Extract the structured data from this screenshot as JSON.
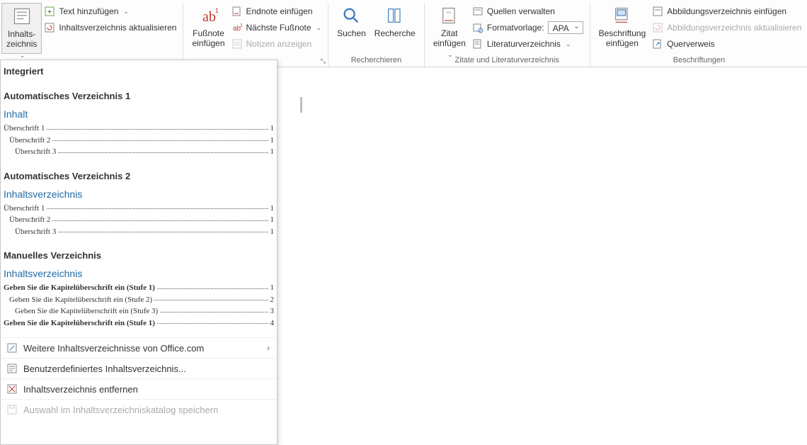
{
  "ribbon": {
    "toc": {
      "label_line1": "Inhalts-",
      "label_line2": "zeichnis"
    },
    "add_text": "Text hinzufügen",
    "update_toc": "Inhaltsverzeichnis aktualisieren",
    "footnote": {
      "label_line1": "Fußnote",
      "label_line2": "einfügen"
    },
    "insert_endnote": "Endnote einfügen",
    "next_footnote": "Nächste Fußnote",
    "show_notes": "Notizen anzeigen",
    "search": "Suchen",
    "research": "Recherche",
    "group_research": "Recherchieren",
    "citation": {
      "label_line1": "Zitat",
      "label_line2": "einfügen"
    },
    "manage_sources": "Quellen verwalten",
    "style_label": "Formatvorlage:",
    "style_value": "APA",
    "bibliography": "Literaturverzeichnis",
    "group_citations": "Zitate und Literaturverzeichnis",
    "caption": {
      "label_line1": "Beschriftung",
      "label_line2": "einfügen"
    },
    "insert_fig_index": "Abbildungsverzeichnis einfügen",
    "update_fig_index": "Abbildungsverzeichnis aktualisieren",
    "crossref": "Querverweis",
    "group_captions": "Beschriftungen"
  },
  "dropdown": {
    "integrated": "Integriert",
    "auto1_title": "Automatisches Verzeichnis 1",
    "auto1_heading": "Inhalt",
    "auto2_title": "Automatisches Verzeichnis 2",
    "auto2_heading": "Inhaltsverzeichnis",
    "manual_title": "Manuelles Verzeichnis",
    "manual_heading": "Inhaltsverzeichnis",
    "h1": "Überschrift 1",
    "h2": "Überschrift 2",
    "h3": "Überschrift 3",
    "m1": "Geben Sie die Kapitelüberschrift ein (Stufe 1)",
    "m2": "Geben Sie die Kapitelüberschrift ein (Stufe 2)",
    "m3": "Geben Sie die Kapitelüberschrift ein (Stufe 3)",
    "m1b": "Geben Sie die Kapitelüberschrift ein (Stufe 1)",
    "p1": "1",
    "p2": "2",
    "p3": "3",
    "p4": "4",
    "more_office": "Weitere Inhaltsverzeichnisse von Office.com",
    "custom": "Benutzerdefiniertes Inhaltsverzeichnis...",
    "remove": "Inhaltsverzeichnis entfernen",
    "save_selection": "Auswahl im Inhaltsverzeichniskatalog speichern"
  }
}
